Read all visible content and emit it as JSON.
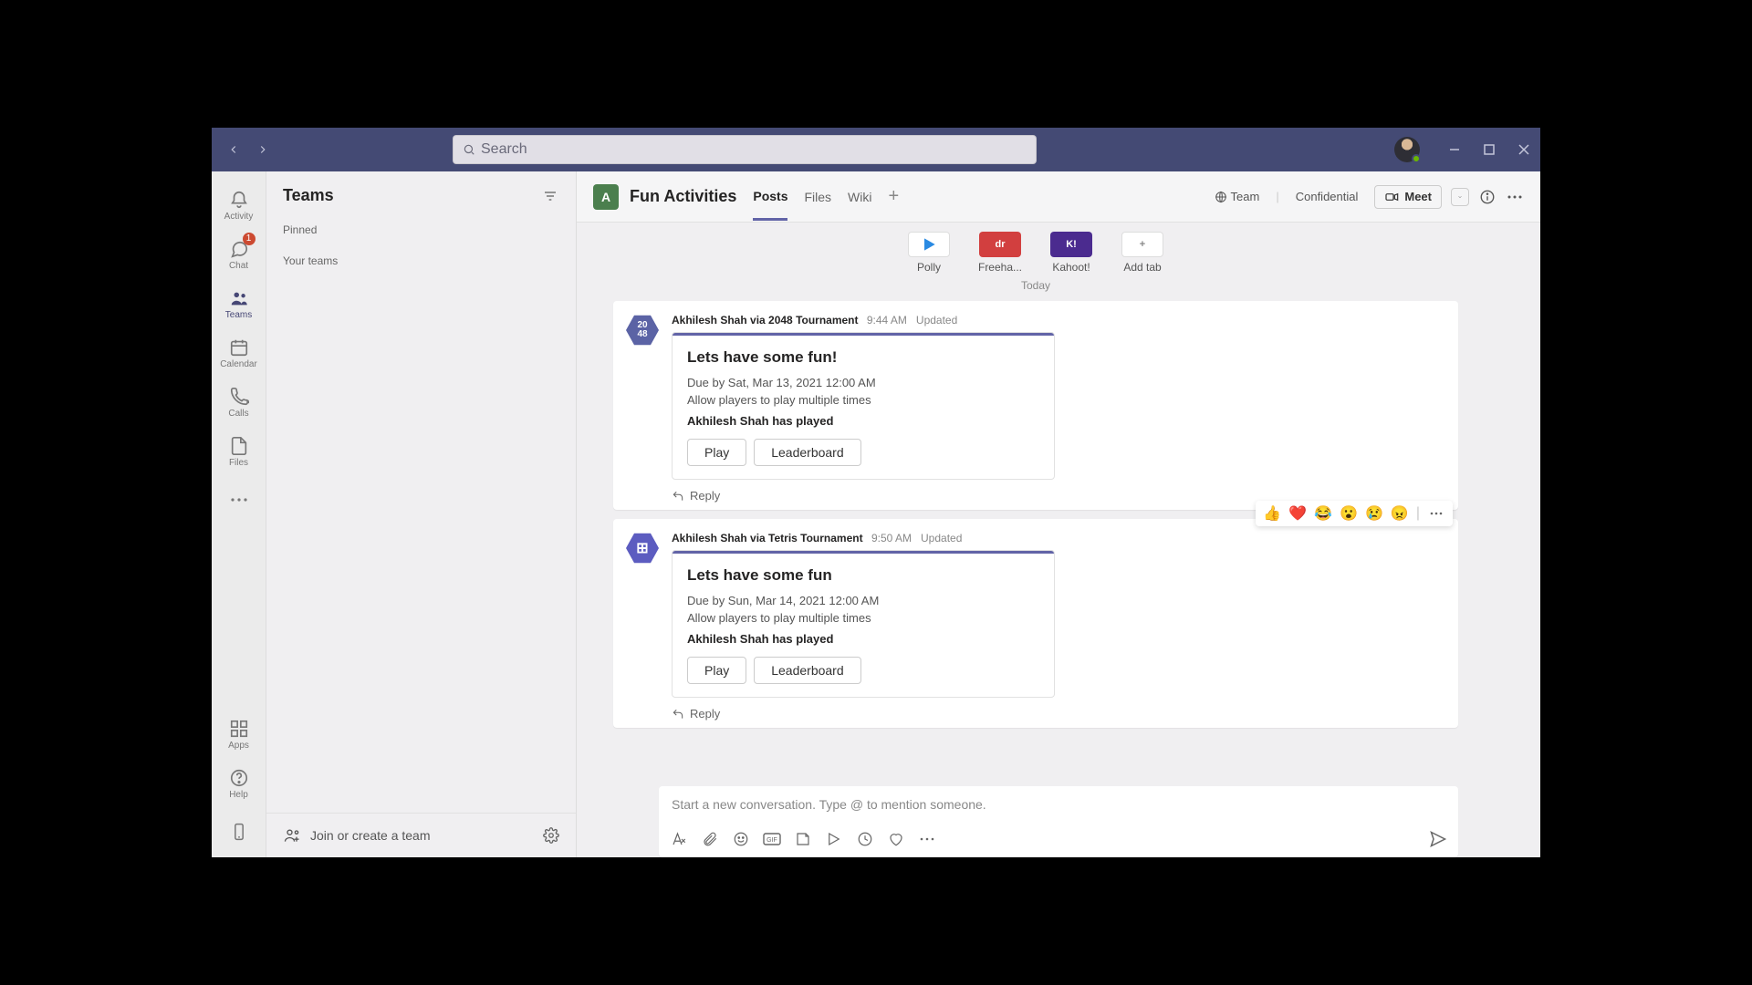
{
  "titlebar": {
    "search_placeholder": "Search"
  },
  "rail": {
    "activity": "Activity",
    "chat": "Chat",
    "chat_badge": "1",
    "teams": "Teams",
    "calendar": "Calendar",
    "calls": "Calls",
    "files": "Files",
    "apps": "Apps",
    "help": "Help"
  },
  "left_panel": {
    "title": "Teams",
    "pinned": "Pinned",
    "your_teams": "Your teams",
    "join_create": "Join or create a team"
  },
  "channel": {
    "avatar_letter": "A",
    "name": "Fun Activities",
    "tabs": {
      "posts": "Posts",
      "files": "Files",
      "wiki": "Wiki"
    },
    "right": {
      "team": "Team",
      "confidential": "Confidential",
      "meet": "Meet"
    }
  },
  "apps_row": {
    "polly": "Polly",
    "freehand": "Freeha...",
    "kahoot": "Kahoot!",
    "addtab": "Add tab"
  },
  "date_sep": "Today",
  "posts": [
    {
      "author": "Akhilesh Shah via 2048 Tournament",
      "time": "9:44 AM",
      "status": "Updated",
      "card": {
        "title": "Lets have some fun!",
        "due": "Due by Sat, Mar 13, 2021 12:00 AM",
        "rule": "Allow players to play multiple times",
        "played": "Akhilesh Shah has played",
        "play": "Play",
        "leaderboard": "Leaderboard"
      },
      "reply": "Reply",
      "avatar_text": "20\n48"
    },
    {
      "author": "Akhilesh Shah via Tetris Tournament",
      "time": "9:50 AM",
      "status": "Updated",
      "card": {
        "title": "Lets have some fun",
        "due": "Due by Sun, Mar 14, 2021 12:00 AM",
        "rule": "Allow players to play multiple times",
        "played": "Akhilesh Shah has played",
        "play": "Play",
        "leaderboard": "Leaderboard"
      },
      "reply": "Reply",
      "avatar_text": "⊞"
    }
  ],
  "reactions": {
    "like": "👍",
    "heart": "❤️",
    "laugh": "😂",
    "surprised": "😮",
    "sad": "😢",
    "angry": "😠"
  },
  "compose": {
    "placeholder": "Start a new conversation. Type @ to mention someone."
  }
}
